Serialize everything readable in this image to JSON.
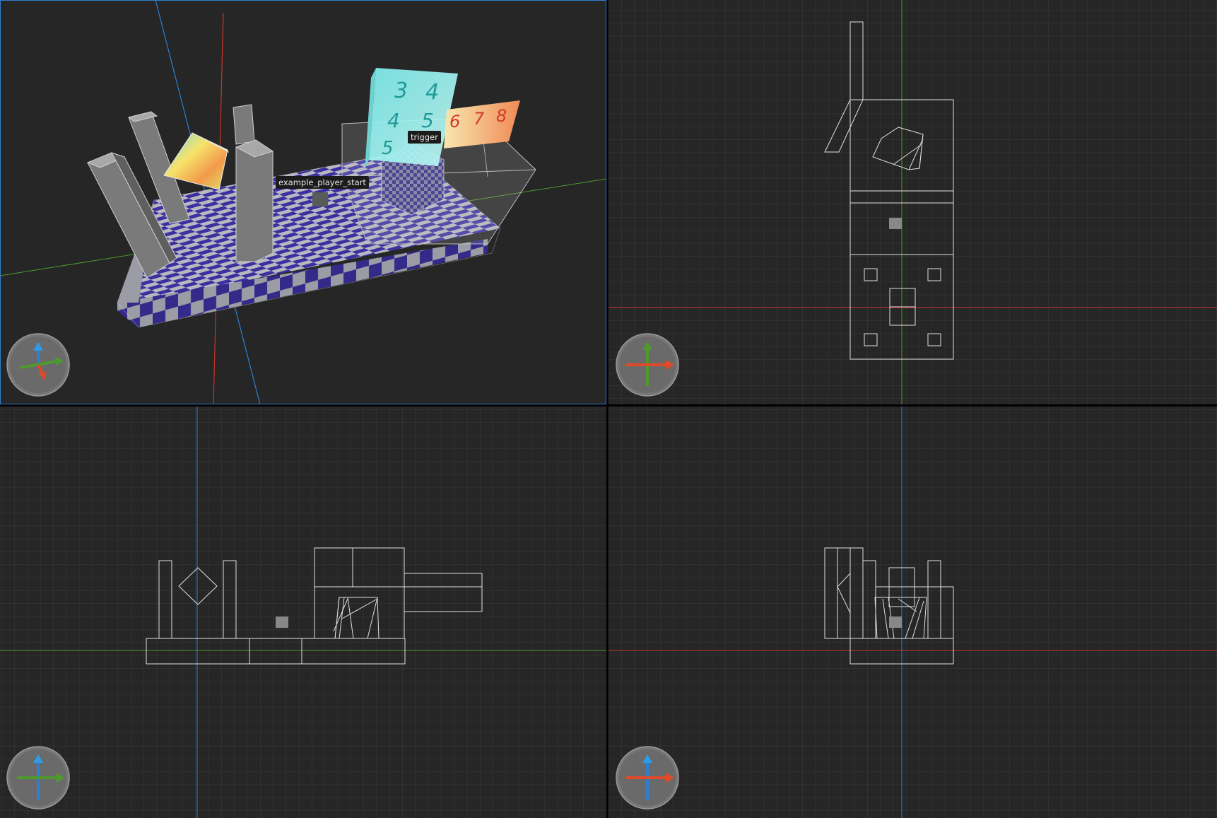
{
  "viewports": {
    "perspective": {
      "view": "3D perspective",
      "labels": {
        "player_start": "example_player_start",
        "trigger": "trigger"
      }
    },
    "top": {
      "view": "Top"
    },
    "front": {
      "view": "Front"
    },
    "side": {
      "view": "Side"
    }
  },
  "texture_digits": {
    "row1": [
      "3",
      "4"
    ],
    "row2": [
      "4",
      "5"
    ],
    "row3": [
      "5"
    ],
    "panel": [
      "6",
      "7",
      "8"
    ]
  },
  "colors": {
    "background": "#262626",
    "grid": "#3a3a3a",
    "axis_x": "#c8352a",
    "axis_y": "#4f9a2e",
    "axis_z": "#2f7fd0",
    "wire": "#e0e0e0",
    "checker_light": "#b8b8c0",
    "checker_dark": "#3c2fa0",
    "selection_border": "#2f7fd0"
  },
  "gizmo_icons": [
    "axis-gizmo-perspective-icon",
    "axis-gizmo-top-icon",
    "axis-gizmo-front-icon",
    "axis-gizmo-side-icon"
  ]
}
